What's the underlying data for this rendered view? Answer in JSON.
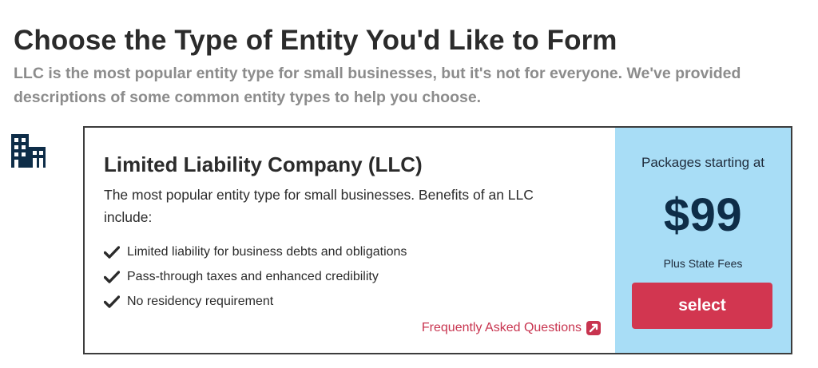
{
  "header": {
    "title": "Choose the Type of Entity You'd Like to Form",
    "subtitle": "LLC is the most popular entity type for small businesses, but it's not for everyone. We've provided descriptions of some common entity types to help you choose."
  },
  "entity": {
    "icon": "building-icon",
    "title": "Limited Liability Company (LLC)",
    "description": "The most popular entity type for small businesses. Benefits of an LLC include:",
    "benefits": [
      "Limited liability for business debts and obligations",
      "Pass-through taxes and enhanced credibility",
      "No residency requirement"
    ],
    "faq_link": "Frequently Asked Questions",
    "pricing": {
      "caption": "Packages starting at",
      "price": "$99",
      "fees_note": "Plus State Fees",
      "select_label": "select"
    }
  },
  "colors": {
    "title_text": "#2b2b2b",
    "subtitle_text": "#8c8c8c",
    "icon_navy": "#0e2d48",
    "pricing_panel_bg": "#a8ddf6",
    "select_button_bg": "#d23650",
    "link_red": "#c8344f",
    "card_border": "#3c3c3c"
  }
}
